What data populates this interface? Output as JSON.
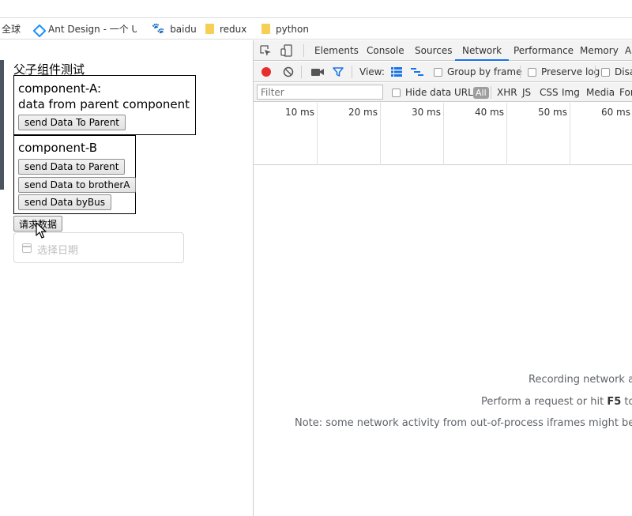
{
  "bookmarks": [
    {
      "label": "全球"
    },
    {
      "label": "Ant Design - 一个 U",
      "icon": "ant-design-icon"
    },
    {
      "label": "baidu",
      "icon": "baidu-paw-icon"
    },
    {
      "label": "redux",
      "icon": "folder-icon"
    },
    {
      "label": "python",
      "icon": "folder-icon"
    }
  ],
  "page": {
    "title": "父子组件测试",
    "componentA": {
      "title": "component-A:",
      "data_text": "data from parent component",
      "button": "send Data To Parent"
    },
    "componentB": {
      "title": "component-B",
      "buttons": [
        "send Data to Parent",
        "send Data to brotherA",
        "send Data byBus"
      ]
    },
    "request_button": "请求数据",
    "date_picker_placeholder": "选择日期"
  },
  "devtools": {
    "tabs": [
      "Elements",
      "Console",
      "Sources",
      "Network",
      "Performance",
      "Memory",
      "A"
    ],
    "active_tab": "Network",
    "toolbar": {
      "view_label": "View:",
      "group_by_frame": "Group by frame",
      "preserve_log": "Preserve log",
      "disable_cache": "Disa"
    },
    "filter": {
      "placeholder": "Filter",
      "hide_data_urls": "Hide data URLs",
      "types": [
        "All",
        "XHR",
        "JS",
        "CSS",
        "Img",
        "Media",
        "For"
      ]
    },
    "timeline_ticks": [
      "10 ms",
      "20 ms",
      "30 ms",
      "40 ms",
      "50 ms",
      "60 ms"
    ],
    "empty_state": {
      "line1": "Recording network ac",
      "line2_prefix": "Perform a request or hit ",
      "line2_key": "F5",
      "line2_suffix": " to re",
      "line3": "Note: some network activity from out-of-process iframes might be mis"
    }
  },
  "colors": {
    "record_red": "#e82d2d",
    "active_tab_underline": "#1a73e8",
    "filter_blue": "#1a73e8",
    "folder_yellow": "#f7cf57"
  }
}
